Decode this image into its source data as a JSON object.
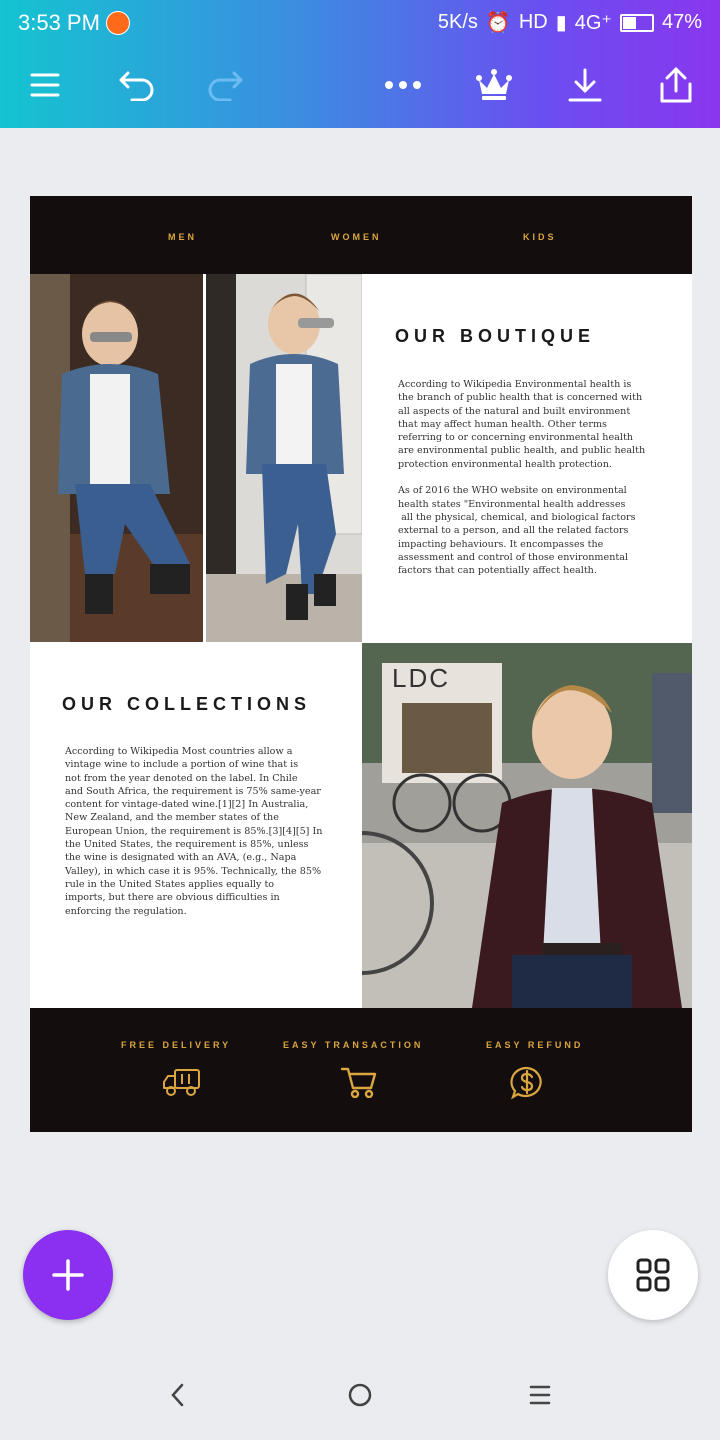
{
  "status_bar": {
    "time": "3:53 PM",
    "speed": "5K/s",
    "hd": "HD",
    "network": "4G⁺",
    "battery": "47%"
  },
  "toolbar": {
    "icons": [
      "menu-icon",
      "undo-icon",
      "redo-icon",
      "more-icon",
      "crown-icon",
      "download-icon",
      "share-icon"
    ]
  },
  "design": {
    "nav": {
      "men": "MEN",
      "women": "WOMEN",
      "kids": "KIDS"
    },
    "boutique": {
      "title": "OUR BOUTIQUE",
      "text": "According to Wikipedia Environmental health is\nthe branch of public health that is concerned with\nall aspects of the natural and built environment\nthat may affect human health. Other terms\nreferring to or concerning environmental health\nare environmental public health, and public health\nprotection environmental health protection.\n\nAs of 2016 the WHO website on environmental\nhealth states \"Environmental health addresses\n all the physical, chemical, and biological factors\nexternal to a person, and all the related factors\nimpacting behaviours. It encompasses the\nassessment and control of those environmental\nfactors that can potentially affect health."
    },
    "collections": {
      "title": "OUR COLLECTIONS",
      "text": "According to Wikipedia Most countries allow a\nvintage wine to include a portion of wine that is\nnot from the year denoted on the label. In Chile\nand South Africa, the requirement is 75% same-year\ncontent for vintage-dated wine.[1][2] In Australia,\nNew Zealand, and the member states of the\nEuropean Union, the requirement is 85%.[3][4][5] In\nthe United States, the requirement is 85%, unless\nthe wine is designated with an AVA, (e.g., Napa\nValley), in which case it is 95%. Technically, the 85%\nrule in the United States applies equally to\nimports, but there are obvious difficulties in\nenforcing the regulation."
    },
    "photo_sign": "LDC",
    "footer": {
      "free_delivery": "FREE DELIVERY",
      "easy_transaction": "EASY TRANSACTION",
      "easy_refund": "EASY REFUND"
    }
  },
  "colors": {
    "gradient_start": "#14c4d0",
    "gradient_end": "#8a36ee",
    "dark_band": "#140d0d",
    "gold": "#d9a640",
    "fab_purple": "#8b2ff0"
  }
}
